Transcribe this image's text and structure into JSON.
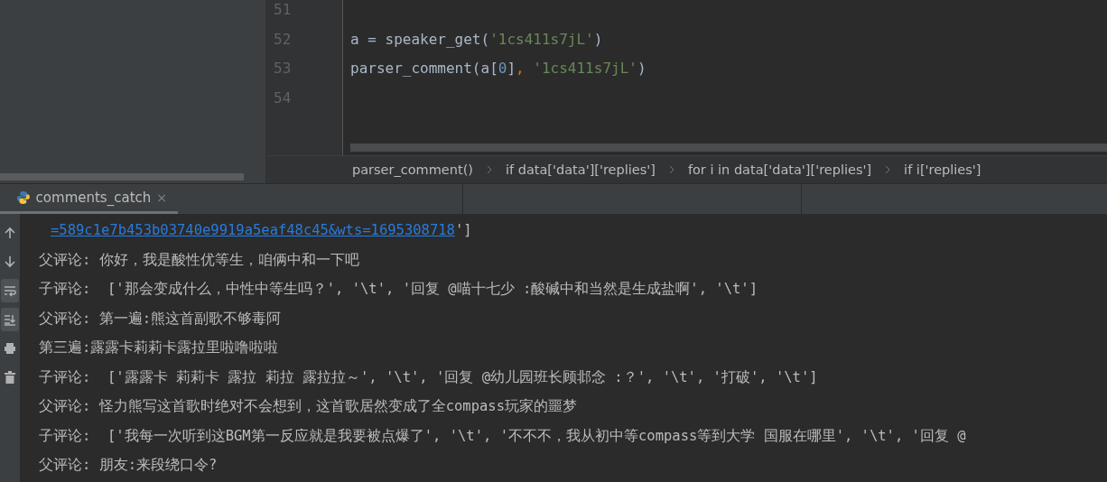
{
  "editor": {
    "lines": [
      {
        "number": "51"
      },
      {
        "number": "52",
        "tokens": [
          {
            "kind": "plain",
            "text": "a = speaker_get("
          },
          {
            "kind": "string",
            "text": "'1cs411s7jL'"
          },
          {
            "kind": "plain",
            "text": ")"
          }
        ]
      },
      {
        "number": "53",
        "tokens": [
          {
            "kind": "plain",
            "text": "parser_comment(a["
          },
          {
            "kind": "number",
            "text": "0"
          },
          {
            "kind": "plain",
            "text": "]"
          },
          {
            "kind": "keyword",
            "text": ", "
          },
          {
            "kind": "string",
            "text": "'1cs411s7jL'"
          },
          {
            "kind": "plain",
            "text": ")"
          }
        ]
      },
      {
        "number": "54"
      }
    ]
  },
  "breadcrumbs": [
    "parser_comment()",
    "if data['data']['replies']",
    "for i in data['data']['replies']",
    "if i['replies']"
  ],
  "run_tab": {
    "title": "comments_catch",
    "close": "×",
    "selected": true
  },
  "toolbar": [
    {
      "kind": "up",
      "on": false
    },
    {
      "kind": "down",
      "on": false
    },
    {
      "kind": "wrap",
      "on": true
    },
    {
      "kind": "scroll-end",
      "on": true
    },
    {
      "kind": "print",
      "on": false
    },
    {
      "kind": "trash",
      "on": false
    }
  ],
  "console": [
    [
      {
        "kind": "link",
        "text": "=589c1e7b453b03740e9919a5eaf48c45&wts=1695308718"
      },
      {
        "kind": "plain",
        "text": "']"
      }
    ],
    [
      {
        "kind": "plain",
        "text": "父评论: 你好，我是酸性优等生，咱俩中和一下吧"
      }
    ],
    [
      {
        "kind": "plain",
        "text": "子评论:  ['那会变成什么，中性中等生吗？', '\\t', '回复 @喵十七少 :酸碱中和当然是生成盐啊', '\\t']"
      }
    ],
    [
      {
        "kind": "plain",
        "text": "父评论: 第一遍:熊这首副歌不够毒阿"
      }
    ],
    [
      {
        "kind": "plain",
        "text": "第三遍:露露卡莉莉卡露拉里啦噜啦啦"
      }
    ],
    [
      {
        "kind": "plain",
        "text": "子评论:  ['露露卡 莉莉卡 露拉 莉拉 露拉拉～', '\\t', '回复 @幼儿园班长顾邶念 :？', '\\t', '打破', '\\t']"
      }
    ],
    [
      {
        "kind": "plain",
        "text": "父评论: 怪力熊写这首歌时绝对不会想到，这首歌居然变成了全compass玩家的噩梦"
      }
    ],
    [
      {
        "kind": "plain",
        "text": "子评论:  ['我每一次听到这BGM第一反应就是我要被点爆了', '\\t', '不不不，我从初中等compass等到大学 国服在哪里', '\\t', '回复 @"
      }
    ],
    [
      {
        "kind": "plain",
        "text": "父评论: 朋友:来段绕口令?"
      }
    ]
  ]
}
